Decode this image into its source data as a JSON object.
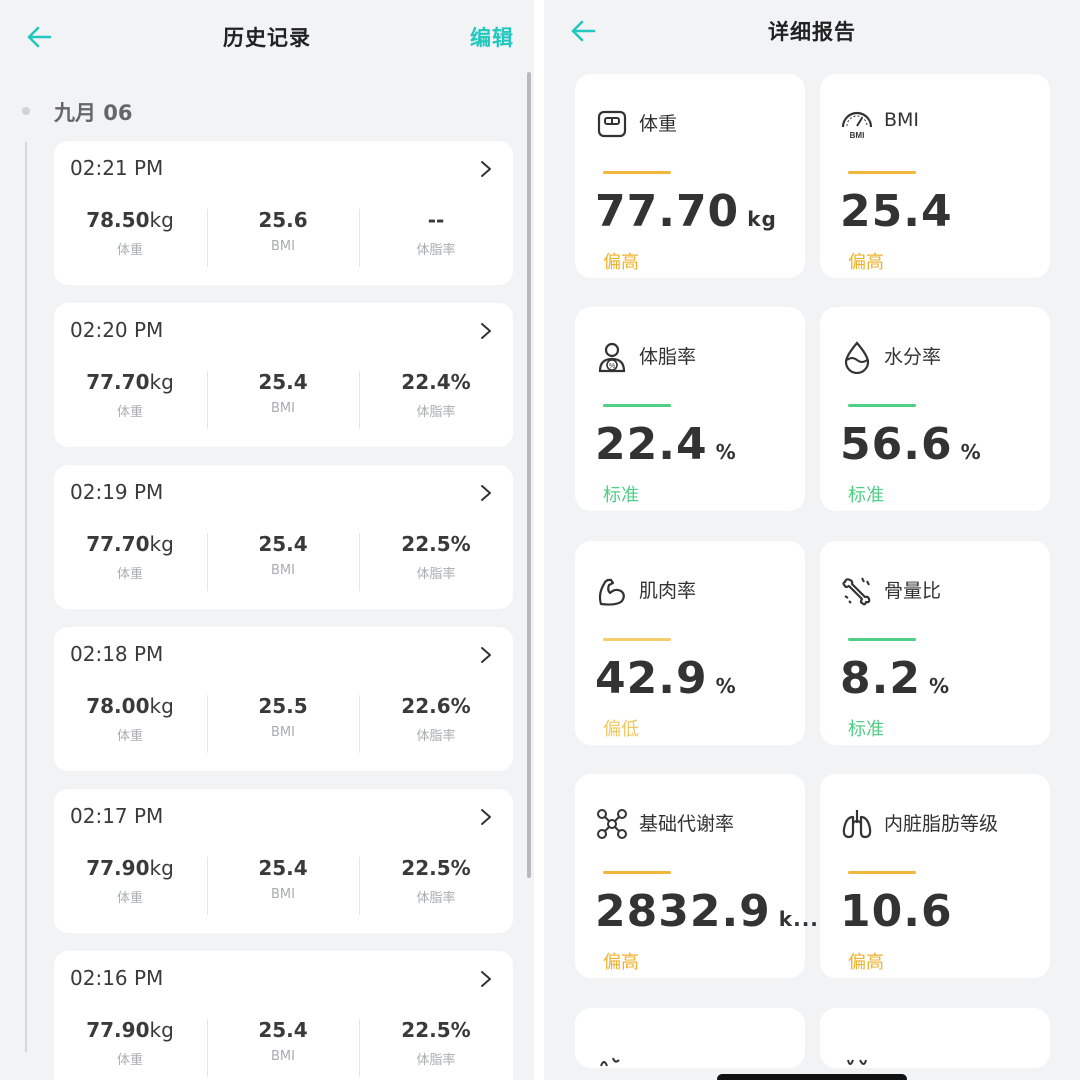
{
  "left": {
    "title": "历史记录",
    "edit_label": "编辑",
    "date_label": "九月 06",
    "records": [
      {
        "time": "02:21 PM",
        "weight_value": "78.50",
        "weight_unit": "kg",
        "weight_label": "体重",
        "bmi": "25.6",
        "bmi_label": "BMI",
        "fat": "--",
        "fat_label": "体脂率"
      },
      {
        "time": "02:20 PM",
        "weight_value": "77.70",
        "weight_unit": "kg",
        "weight_label": "体重",
        "bmi": "25.4",
        "bmi_label": "BMI",
        "fat": "22.4%",
        "fat_label": "体脂率"
      },
      {
        "time": "02:19 PM",
        "weight_value": "77.70",
        "weight_unit": "kg",
        "weight_label": "体重",
        "bmi": "25.4",
        "bmi_label": "BMI",
        "fat": "22.5%",
        "fat_label": "体脂率"
      },
      {
        "time": "02:18 PM",
        "weight_value": "78.00",
        "weight_unit": "kg",
        "weight_label": "体重",
        "bmi": "25.5",
        "bmi_label": "BMI",
        "fat": "22.6%",
        "fat_label": "体脂率"
      },
      {
        "time": "02:17 PM",
        "weight_value": "77.90",
        "weight_unit": "kg",
        "weight_label": "体重",
        "bmi": "25.4",
        "bmi_label": "BMI",
        "fat": "22.5%",
        "fat_label": "体脂率"
      },
      {
        "time": "02:16 PM",
        "weight_value": "77.90",
        "weight_unit": "kg",
        "weight_label": "体重",
        "bmi": "25.4",
        "bmi_label": "BMI",
        "fat": "22.5%",
        "fat_label": "体脂率"
      }
    ]
  },
  "right": {
    "title": "详细报告",
    "metrics": [
      {
        "name": "体重",
        "value": "77.70",
        "unit": "kg",
        "status": "偏高",
        "icon": "scale-icon",
        "level": "high"
      },
      {
        "name": "BMI",
        "value": "25.4",
        "unit": "",
        "status": "偏高",
        "icon": "gauge-bmi-icon",
        "level": "high"
      },
      {
        "name": "体脂率",
        "value": "22.4",
        "unit": "%",
        "status": "标准",
        "icon": "body-fat-icon",
        "level": "normal"
      },
      {
        "name": "水分率",
        "value": "56.6",
        "unit": "%",
        "status": "标准",
        "icon": "water-drop-icon",
        "level": "normal"
      },
      {
        "name": "肌肉率",
        "value": "42.9",
        "unit": "%",
        "status": "偏低",
        "icon": "muscle-arm-icon",
        "level": "low"
      },
      {
        "name": "骨量比",
        "value": "8.2",
        "unit": "%",
        "status": "标准",
        "icon": "bone-icon",
        "level": "normal"
      },
      {
        "name": "基础代谢率",
        "value": "2832.9",
        "unit": "k...",
        "status": "偏高",
        "icon": "metabolism-molecule-icon",
        "level": "high"
      },
      {
        "name": "内脏脂肪等级",
        "value": "10.6",
        "unit": "",
        "status": "偏高",
        "icon": "lungs-organ-icon",
        "level": "high"
      }
    ]
  },
  "colors": {
    "accent": "#22c7bd",
    "high": "#f0b73a",
    "low": "#f5cd6e",
    "normal": "#4fcf86",
    "status_high_text": "#efb12e",
    "status_low_text": "#f0c861",
    "status_normal_text": "#4fcf86"
  }
}
